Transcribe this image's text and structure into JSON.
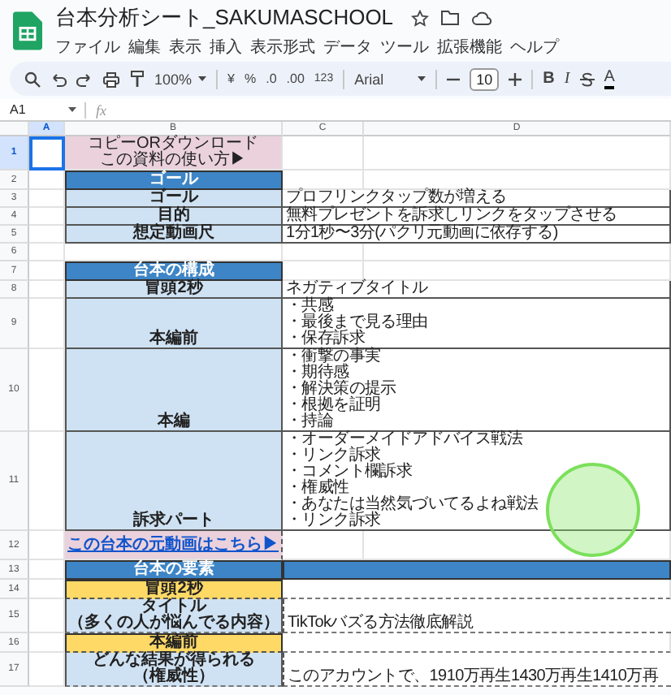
{
  "app": {
    "title": "台本分析シート_SAKUMASCHOOL",
    "menu": [
      "ファイル",
      "編集",
      "表示",
      "挿入",
      "表示形式",
      "データ",
      "ツール",
      "拡張機能",
      "ヘルプ"
    ]
  },
  "toolbar": {
    "zoom": "100%",
    "currency": "¥",
    "percent": "%",
    "decrease_decimal": ".0",
    "increase_decimal": ".00",
    "number_format": "123",
    "font": "Arial",
    "font_size": "10",
    "bold": "B",
    "italic": "I",
    "text_color": "A"
  },
  "formula_bar": {
    "cell_ref": "A1",
    "function_label": "fx"
  },
  "columns": [
    {
      "label": "A",
      "selected": true
    },
    {
      "label": "B",
      "selected": false
    },
    {
      "label": "C",
      "selected": false
    },
    {
      "label": "D",
      "selected": false
    }
  ],
  "rows": [
    {
      "number": "1",
      "selected": true,
      "kind": "pink",
      "label": [
        "コピーORダウンロード",
        "この資料の使い方▶"
      ]
    },
    {
      "number": "2",
      "selected": false,
      "kind": "section",
      "label": [
        "ゴール"
      ]
    },
    {
      "number": "3",
      "selected": false,
      "kind": "label",
      "label": [
        "ゴール"
      ],
      "value": [
        "プロフリンクタップ数が増える"
      ]
    },
    {
      "number": "4",
      "selected": false,
      "kind": "label",
      "label": [
        "目的"
      ],
      "value": [
        "無料プレゼントを訴求しリンクをタップさせる"
      ]
    },
    {
      "number": "5",
      "selected": false,
      "kind": "label",
      "label": [
        "想定動画尺"
      ],
      "value": [
        "1分1秒〜3分(パクリ元動画に依存する)"
      ]
    },
    {
      "number": "6",
      "selected": false,
      "kind": "blank"
    },
    {
      "number": "7",
      "selected": false,
      "kind": "section",
      "label": [
        "台本の構成"
      ]
    },
    {
      "number": "8",
      "selected": false,
      "kind": "label",
      "label": [
        "冒頭2秒"
      ],
      "value": [
        "ネガティブタイトル"
      ]
    },
    {
      "number": "9",
      "selected": false,
      "kind": "label",
      "label": [
        "本編前"
      ],
      "value": [
        "・共感",
        "・最後まで見る理由",
        "・保存訴求"
      ]
    },
    {
      "number": "10",
      "selected": false,
      "kind": "label",
      "label": [
        "本編"
      ],
      "value": [
        "・衝撃の事実",
        "・期待感",
        "・解決策の提示",
        "・根拠を証明",
        "・持論"
      ]
    },
    {
      "number": "11",
      "selected": false,
      "kind": "label",
      "label": [
        "訴求パート"
      ],
      "value": [
        "・オーダーメイドアドバイス戦法",
        "・リンク訴求",
        "・コメント欄訴求",
        "・権威性",
        "・あなたは当然気づいてるよね戦法",
        "・リンク訴求"
      ]
    },
    {
      "number": "12",
      "selected": false,
      "kind": "link",
      "label": [
        "この台本の元動画はこちら▶"
      ]
    },
    {
      "number": "13",
      "selected": false,
      "kind": "section-wide",
      "label": [
        "台本の要素"
      ]
    },
    {
      "number": "14",
      "selected": false,
      "kind": "yellow",
      "label": [
        "冒頭2秒"
      ]
    },
    {
      "number": "15",
      "selected": false,
      "kind": "element",
      "label": [
        "タイトル",
        "（多くの人が悩んでる内容）"
      ],
      "value": [
        "TikTokバズる方法徹底解説"
      ]
    },
    {
      "number": "16",
      "selected": false,
      "kind": "yellow",
      "label": [
        "本編前"
      ]
    },
    {
      "number": "17",
      "selected": false,
      "kind": "element",
      "label": [
        "どんな結果が得られる",
        "（権威性）"
      ],
      "value": [
        "このアカウントで、1910万再生1430万再生1410万再"
      ]
    }
  ]
}
